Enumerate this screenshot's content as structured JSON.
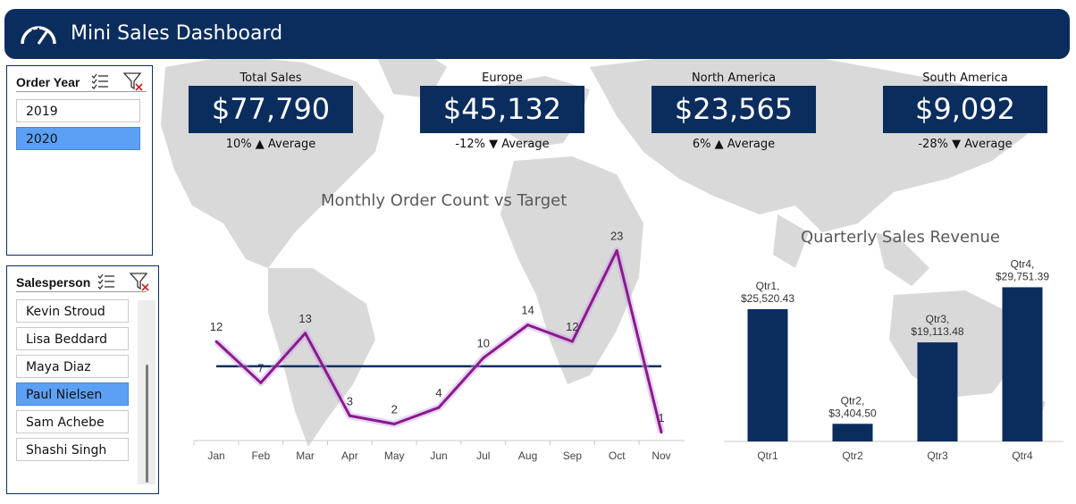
{
  "header": {
    "title": "Mini Sales Dashboard",
    "icon": "speedometer-icon"
  },
  "slicers": {
    "order_year": {
      "title": "Order Year",
      "items": [
        {
          "label": "2019",
          "selected": false
        },
        {
          "label": "2020",
          "selected": true
        }
      ]
    },
    "salesperson": {
      "title": "Salesperson",
      "items": [
        {
          "label": "Kevin Stroud",
          "selected": false
        },
        {
          "label": "Lisa Beddard",
          "selected": false
        },
        {
          "label": "Maya Diaz",
          "selected": false
        },
        {
          "label": "Paul Nielsen",
          "selected": true
        },
        {
          "label": "Sam Achebe",
          "selected": false
        },
        {
          "label": "Shashi Singh",
          "selected": false
        }
      ]
    }
  },
  "kpis": [
    {
      "label": "Total Sales",
      "value": "$77,790",
      "change": "10%",
      "direction": "up",
      "arrow": "▲",
      "note": "Average"
    },
    {
      "label": "Europe",
      "value": "$45,132",
      "change": "-12%",
      "direction": "down",
      "arrow": "▼",
      "note": "Average"
    },
    {
      "label": "North America",
      "value": "$23,565",
      "change": "6%",
      "direction": "up",
      "arrow": "▲",
      "note": "Average"
    },
    {
      "label": "South America",
      "value": "$9,092",
      "change": "-28%",
      "direction": "down",
      "arrow": "▼",
      "note": "Average"
    }
  ],
  "colors": {
    "navy": "#0b2d5e",
    "line": "#8b1a8b",
    "selected": "#5ba0f5",
    "map": "#d9d9d9"
  },
  "chart_data": [
    {
      "type": "line",
      "title": "Monthly Order Count vs Target",
      "categories": [
        "Jan",
        "Feb",
        "Mar",
        "Apr",
        "May",
        "Jun",
        "Jul",
        "Aug",
        "Sep",
        "Oct",
        "Nov"
      ],
      "series": [
        {
          "values": [
            12,
            7,
            13,
            3,
            2,
            4,
            10,
            14,
            12,
            23,
            1
          ]
        }
      ],
      "target": 9,
      "ylim": [
        0,
        25
      ],
      "data_labels": true
    },
    {
      "type": "bar",
      "title": "Quarterly Sales Revenue",
      "categories": [
        "Qtr1",
        "Qtr2",
        "Qtr3",
        "Qtr4"
      ],
      "values": [
        25520.43,
        3404.5,
        19113.48,
        29751.39
      ],
      "data_labels": [
        [
          "Qtr1,",
          "$25,520.43"
        ],
        [
          "Qtr2,",
          "$3,404.50"
        ],
        [
          "Qtr3,",
          "$19,113.48"
        ],
        [
          "Qtr4,",
          "$29,751.39"
        ]
      ],
      "ylim": [
        0,
        30000
      ]
    }
  ]
}
